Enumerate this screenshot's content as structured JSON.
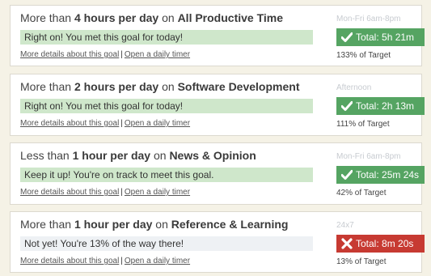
{
  "goals": [
    {
      "prefix": "More than",
      "amount": "4 hours per day",
      "on_word": "on",
      "category": "All Productive Time",
      "status": "Right on! You met this goal for today!",
      "schedule": "Mon-Fri 6am-8pm",
      "total": "Total: 5h 21m",
      "target": "133% of Target",
      "state": "met",
      "details_link": "More details about this goal",
      "timer_link": "Open a daily timer"
    },
    {
      "prefix": "More than",
      "amount": "2 hours per day",
      "on_word": "on",
      "category": "Software Development",
      "status": "Right on! You met this goal for today!",
      "schedule": "Afternoon",
      "total": "Total: 2h 13m",
      "target": "111% of Target",
      "state": "met",
      "details_link": "More details about this goal",
      "timer_link": "Open a daily timer"
    },
    {
      "prefix": "Less than",
      "amount": "1 hour per day",
      "on_word": "on",
      "category": "News & Opinion",
      "status": "Keep it up! You're on track to meet this goal.",
      "schedule": "Mon-Fri 6am-8pm",
      "total": "Total: 25m 24s",
      "target": "42% of Target",
      "state": "on-track",
      "details_link": "More details about this goal",
      "timer_link": "Open a daily timer"
    },
    {
      "prefix": "More than",
      "amount": "1 hour per day",
      "on_word": "on",
      "category": "Reference & Learning",
      "status": "Not yet! You're 13% of the way there!",
      "schedule": "24x7",
      "total": "Total: 8m 20s",
      "target": "13% of Target",
      "state": "not-met",
      "details_link": "More details about this goal",
      "timer_link": "Open a daily timer"
    }
  ],
  "colors": {
    "success": "#55a462",
    "failure": "#c73a32",
    "success_bar": "#cfe7cb",
    "neutral_bar": "#eef1f4"
  },
  "icons": {
    "success": "checkmark-icon",
    "failure": "x-icon"
  }
}
